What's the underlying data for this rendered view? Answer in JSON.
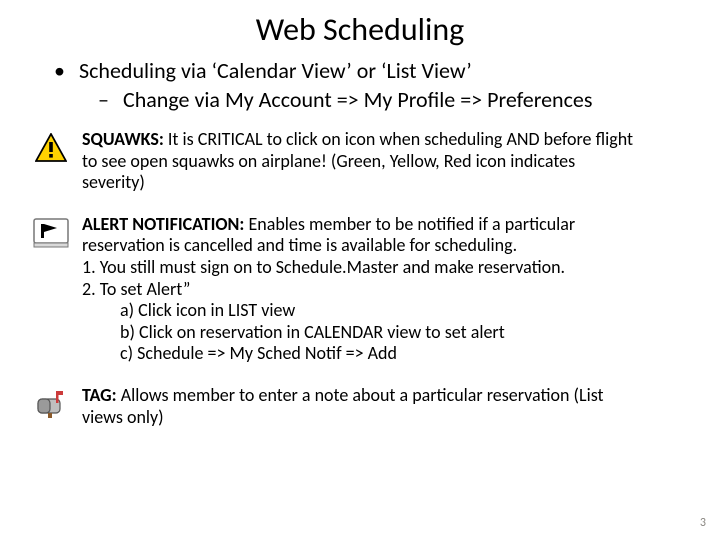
{
  "title": "Web Scheduling",
  "bullets": {
    "b1": "Scheduling via ‘Calendar View’ or ‘List View’",
    "b2": "Change via My Account => My Profile => Preferences"
  },
  "squawks": {
    "label": "SQUAWKS:",
    "text": "  It is CRITICAL to click on icon when scheduling AND before flight to see open squawks on airplane!  (Green, Yellow, Red icon indicates severity)"
  },
  "alert": {
    "label": "ALERT NOTIFICATION:",
    "intro": "  Enables member to be notified if a particular reservation is cancelled and time is available for scheduling.",
    "l1": "1.  You still must sign on to Schedule.Master and make reservation.",
    "l2": "2.  To set Alert”",
    "a": "a)    Click icon in LIST view",
    "b": "b)    Click on reservation in CALENDAR view to set alert",
    "c": "c)    Schedule =>  My Sched Notif =>  Add"
  },
  "tag": {
    "label": "TAG:",
    "text": "  Allows member to enter a note about a particular reservation  (List views only)"
  },
  "page": "3"
}
